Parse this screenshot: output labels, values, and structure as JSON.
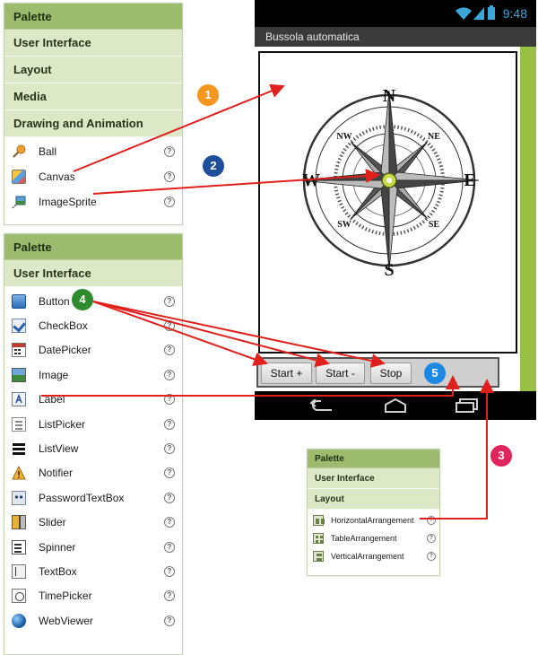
{
  "palette1": {
    "header": "Palette",
    "categories": [
      "User Interface",
      "Layout",
      "Media",
      "Drawing and Animation"
    ],
    "items": [
      {
        "label": "Ball",
        "icon": "ball-icon"
      },
      {
        "label": "Canvas",
        "icon": "canvas-icon"
      },
      {
        "label": "ImageSprite",
        "icon": "imagesprite-icon"
      }
    ]
  },
  "palette2": {
    "header": "Palette",
    "category": "User Interface",
    "items": [
      {
        "label": "Button",
        "icon": "button-icon"
      },
      {
        "label": "CheckBox",
        "icon": "checkbox-icon"
      },
      {
        "label": "DatePicker",
        "icon": "datepicker-icon"
      },
      {
        "label": "Image",
        "icon": "image-icon"
      },
      {
        "label": "Label",
        "icon": "label-icon"
      },
      {
        "label": "ListPicker",
        "icon": "listpicker-icon"
      },
      {
        "label": "ListView",
        "icon": "listview-icon"
      },
      {
        "label": "Notifier",
        "icon": "notifier-icon"
      },
      {
        "label": "PasswordTextBox",
        "icon": "passwordtextbox-icon"
      },
      {
        "label": "Slider",
        "icon": "slider-icon"
      },
      {
        "label": "Spinner",
        "icon": "spinner-icon"
      },
      {
        "label": "TextBox",
        "icon": "textbox-icon"
      },
      {
        "label": "TimePicker",
        "icon": "timepicker-icon"
      },
      {
        "label": "WebViewer",
        "icon": "webviewer-icon"
      }
    ]
  },
  "palette3": {
    "header": "Palette",
    "categories": [
      "User Interface",
      "Layout"
    ],
    "items": [
      {
        "label": "HorizontalArrangement",
        "icon": "horizontalarrangement-icon"
      },
      {
        "label": "TableArrangement",
        "icon": "tablearrangement-icon"
      },
      {
        "label": "VerticalArrangement",
        "icon": "verticalarrangement-icon"
      }
    ]
  },
  "phone": {
    "time": "9:48",
    "title": "Bussola automatica",
    "compass": {
      "n": "N",
      "s": "S",
      "e": "E",
      "w": "W",
      "ne": "NE",
      "nw": "NW",
      "se": "SE",
      "sw": "SW"
    },
    "buttons": [
      "Start +",
      "Start -",
      "Stop"
    ]
  },
  "markers": [
    {
      "n": "1",
      "color": "#f5961e"
    },
    {
      "n": "2",
      "color": "#1f4e9c"
    },
    {
      "n": "3",
      "color": "#e0245e"
    },
    {
      "n": "4",
      "color": "#2e8b2e"
    },
    {
      "n": "5",
      "color": "#1e88e5"
    }
  ],
  "help_glyph": "?",
  "colors": {
    "arrow": "#e0201c",
    "palette_header": "#9cbb6c",
    "palette_category": "#dce8c6",
    "phone_accent": "#98c044"
  }
}
